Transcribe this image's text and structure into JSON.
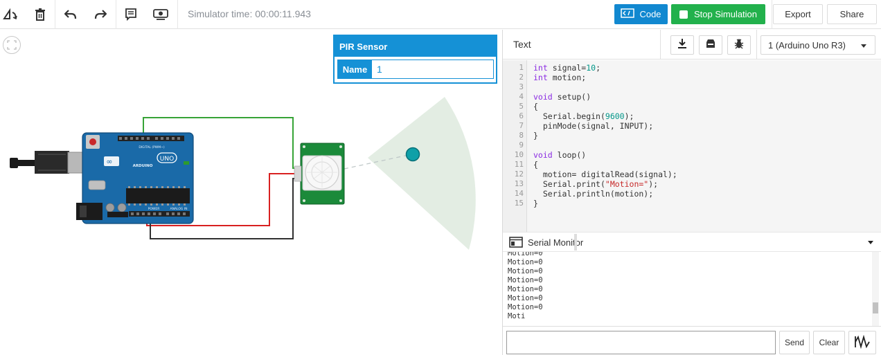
{
  "toolbar": {
    "icons": [
      "rotate-icon",
      "delete-icon",
      "undo-icon",
      "redo-icon",
      "notes-icon",
      "visibility-icon"
    ],
    "sim_time": "Simulator time: 00:00:11.943",
    "code_label": "Code",
    "stop_label": "Stop Simulation",
    "export_label": "Export",
    "share_label": "Share",
    "code_color": "#1188d0",
    "stop_color": "#22b14c"
  },
  "inspector": {
    "title": "PIR Sensor",
    "name_label": "Name",
    "name_value": "1",
    "color": "#1591d6"
  },
  "board": {
    "brand": "ARDUINO",
    "model": "UNO",
    "digital_label": "DIGITAL (PWM~)",
    "power_label": "POWER",
    "analog_label": "ANALOG IN"
  },
  "editor": {
    "mode_label": "Text",
    "device_select": "1 (Arduino Uno R3)",
    "line_numbers": [
      "1",
      "2",
      "3",
      "4",
      "5",
      "6",
      "7",
      "8",
      "9",
      "10",
      "11",
      "12",
      "13",
      "14",
      "15"
    ],
    "code_lines": [
      "int signal=10;",
      "int motion;",
      "",
      "void setup()",
      "{",
      "  Serial.begin(9600);",
      "  pinMode(signal, INPUT);",
      "}",
      "",
      "void loop()",
      "{",
      "  motion= digitalRead(signal);",
      "  Serial.print(\"Motion=\");",
      "  Serial.println(motion);",
      "}"
    ]
  },
  "serial_monitor": {
    "title": "Serial Monitor",
    "lines": [
      "Motion=0",
      "Motion=0",
      "Motion=0",
      "Motion=0",
      "Motion=0",
      "Motion=0",
      "Motion=0",
      "Moti"
    ],
    "input_value": "",
    "send_label": "Send",
    "clear_label": "Clear"
  }
}
